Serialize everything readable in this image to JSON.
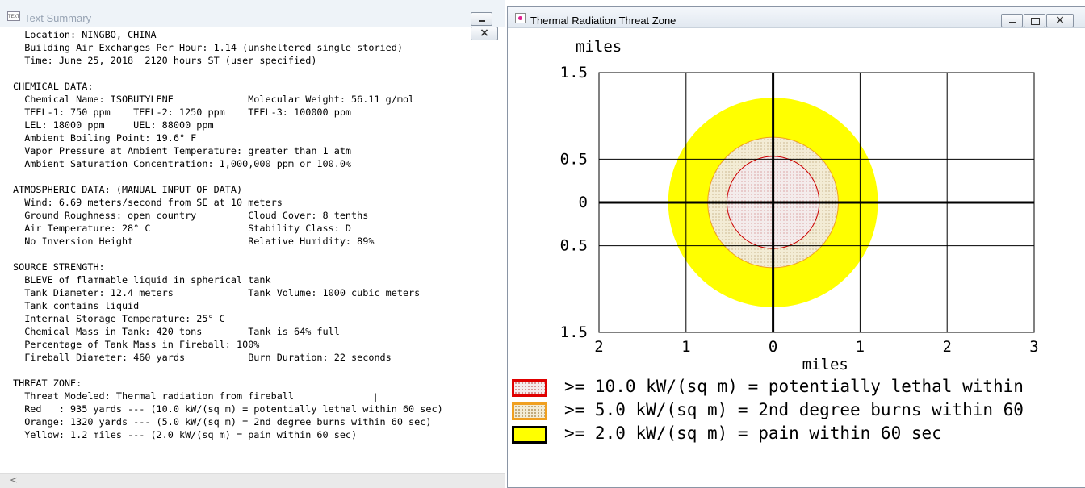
{
  "text_window": {
    "title": "Text Summary",
    "icon_label": "TEXT",
    "lines": [
      "  Location: NINGBO, CHINA",
      "  Building Air Exchanges Per Hour: 1.14 (unsheltered single storied)",
      "  Time: June 25, 2018  2120 hours ST (user specified)",
      "",
      "CHEMICAL DATA:",
      "  Chemical Name: ISOBUTYLENE             Molecular Weight: 56.11 g/mol",
      "  TEEL-1: 750 ppm    TEEL-2: 1250 ppm    TEEL-3: 100000 ppm",
      "  LEL: 18000 ppm     UEL: 88000 ppm",
      "  Ambient Boiling Point: 19.6° F",
      "  Vapor Pressure at Ambient Temperature: greater than 1 atm",
      "  Ambient Saturation Concentration: 1,000,000 ppm or 100.0%",
      "",
      "ATMOSPHERIC DATA: (MANUAL INPUT OF DATA)",
      "  Wind: 6.69 meters/second from SE at 10 meters",
      "  Ground Roughness: open country         Cloud Cover: 8 tenths",
      "  Air Temperature: 28° C                 Stability Class: D",
      "  No Inversion Height                    Relative Humidity: 89%",
      "",
      "SOURCE STRENGTH:",
      "  BLEVE of flammable liquid in spherical tank",
      "  Tank Diameter: 12.4 meters             Tank Volume: 1000 cubic meters",
      "  Tank contains liquid",
      "  Internal Storage Temperature: 25° C",
      "  Chemical Mass in Tank: 420 tons        Tank is 64% full",
      "  Percentage of Tank Mass in Fireball: 100%",
      "  Fireball Diameter: 460 yards           Burn Duration: 22 seconds",
      "",
      "THREAT ZONE:",
      "  Threat Modeled: Thermal radiation from fireball",
      "  Red   : 935 yards --- (10.0 kW/(sq m) = potentially lethal within 60 sec)",
      "  Orange: 1320 yards --- (5.0 kW/(sq m) = 2nd degree burns within 60 sec)",
      "  Yellow: 1.2 miles --- (2.0 kW/(sq m) = pain within 60 sec)"
    ],
    "scroll_arrow": "<",
    "cursor": "I"
  },
  "plot_window": {
    "title": "Thermal Radiation Threat Zone",
    "legend": [
      {
        "text": ">= 10.0 kW/(sq m) = potentially lethal within",
        "swatch": "red"
      },
      {
        "text": ">= 5.0 kW/(sq m) = 2nd degree burns within 60",
        "swatch": "orange"
      },
      {
        "text": ">= 2.0 kW/(sq m) = pain within 60 sec",
        "swatch": "yellow"
      }
    ]
  },
  "chart_data": {
    "type": "threat-zone",
    "xlabel": "miles",
    "ylabel": "miles",
    "x_ticks": [
      {
        "value": -2,
        "label": "2"
      },
      {
        "value": -1,
        "label": "1"
      },
      {
        "value": 0,
        "label": "0"
      },
      {
        "value": 1,
        "label": "1"
      },
      {
        "value": 2,
        "label": "2"
      },
      {
        "value": 3,
        "label": "3"
      }
    ],
    "y_ticks": [
      {
        "value": 1.5,
        "label": "1.5"
      },
      {
        "value": 0.5,
        "label": "0.5"
      },
      {
        "value": 0,
        "label": "0"
      },
      {
        "value": -0.5,
        "label": "0.5"
      },
      {
        "value": -1.5,
        "label": "1.5"
      }
    ],
    "xlim": [
      -2,
      3
    ],
    "ylim": [
      -1.5,
      1.5
    ],
    "grid": true,
    "zones": [
      {
        "name": "Yellow",
        "radius_miles": 1.2,
        "fill": "#ffff00",
        "stroke": "#ffff00",
        "pattern": "none"
      },
      {
        "name": "Orange",
        "radius_miles": 0.75,
        "fill": "#f3ecd5",
        "stroke": "#f0a020",
        "pattern": "dots"
      },
      {
        "name": "Red",
        "radius_miles": 0.53,
        "fill": "#f4ecec",
        "stroke": "#cc0000",
        "pattern": "dots"
      }
    ]
  }
}
